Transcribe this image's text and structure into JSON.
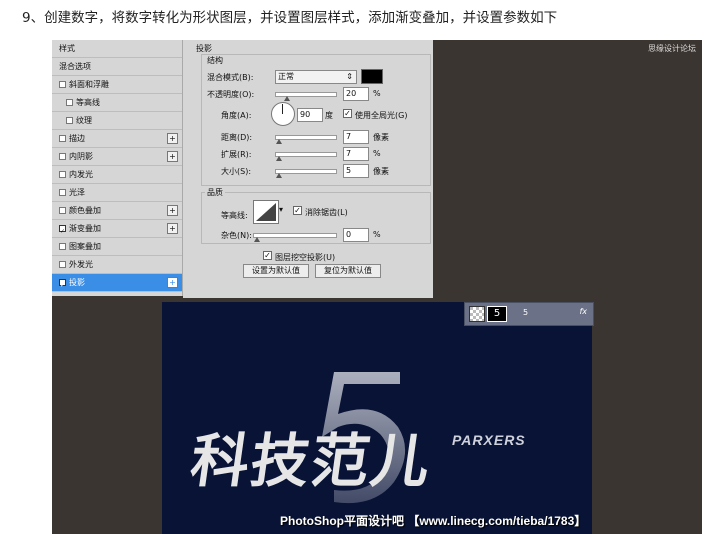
{
  "caption": "9、创建数字，将数字转化为形状图层，并设置图层样式，添加渐变叠加，并设置参数如下",
  "watermark_top": "思缘设计论坛",
  "styles_list": [
    {
      "label": "样式",
      "checkbox": false,
      "checked": false,
      "plus": false,
      "selected": false
    },
    {
      "label": "混合选项",
      "checkbox": false,
      "checked": false,
      "plus": false,
      "selected": false
    },
    {
      "label": "斜面和浮雕",
      "checkbox": true,
      "checked": false,
      "plus": false,
      "selected": false
    },
    {
      "label": "等高线",
      "checkbox": true,
      "checked": false,
      "plus": false,
      "selected": false,
      "indent": true
    },
    {
      "label": "纹理",
      "checkbox": true,
      "checked": false,
      "plus": false,
      "selected": false,
      "indent": true
    },
    {
      "label": "描边",
      "checkbox": true,
      "checked": false,
      "plus": true,
      "selected": false
    },
    {
      "label": "内阴影",
      "checkbox": true,
      "checked": false,
      "plus": true,
      "selected": false
    },
    {
      "label": "内发光",
      "checkbox": true,
      "checked": false,
      "plus": false,
      "selected": false
    },
    {
      "label": "光泽",
      "checkbox": true,
      "checked": false,
      "plus": false,
      "selected": false
    },
    {
      "label": "颜色叠加",
      "checkbox": true,
      "checked": false,
      "plus": true,
      "selected": false
    },
    {
      "label": "渐变叠加",
      "checkbox": true,
      "checked": true,
      "plus": true,
      "selected": false
    },
    {
      "label": "图案叠加",
      "checkbox": true,
      "checked": false,
      "plus": false,
      "selected": false
    },
    {
      "label": "外发光",
      "checkbox": true,
      "checked": false,
      "plus": false,
      "selected": false
    },
    {
      "label": "投影",
      "checkbox": true,
      "checked": true,
      "plus": true,
      "selected": true
    }
  ],
  "panel": {
    "section_title": "投影",
    "structure_title": "结构",
    "blend_mode_label": "混合模式(B):",
    "blend_mode_value": "正常",
    "opacity_label": "不透明度(O):",
    "opacity_value": "20",
    "opacity_unit": "%",
    "angle_label": "角度(A):",
    "angle_value": "90",
    "angle_unit": "度",
    "global_light_label": "使用全局光(G)",
    "distance_label": "距离(D):",
    "distance_value": "7",
    "distance_unit": "像素",
    "spread_label": "扩展(R):",
    "spread_value": "7",
    "spread_unit": "%",
    "size_label": "大小(S):",
    "size_value": "5",
    "size_unit": "像素",
    "quality_title": "品质",
    "contour_label": "等高线:",
    "antialias_label": "消除锯齿(L)",
    "noise_label": "杂色(N):",
    "noise_value": "0",
    "noise_unit": "%",
    "knockout_label": "图层挖空投影(U)",
    "set_default_label": "设置为默认值",
    "reset_default_label": "复位为默认值",
    "shadow_color": "#000000"
  },
  "layer_bar": {
    "number": "5",
    "name": "5",
    "fx": "fx"
  },
  "artwork": {
    "big_number": "5",
    "main_text": "科技范儿",
    "sub_text": "PARXERS",
    "footer_text": "PhotoShop平面设计吧 【www.linecg.com/tieba/1783】",
    "bg_color": "#081335",
    "text_color": "#e8e8e8"
  }
}
